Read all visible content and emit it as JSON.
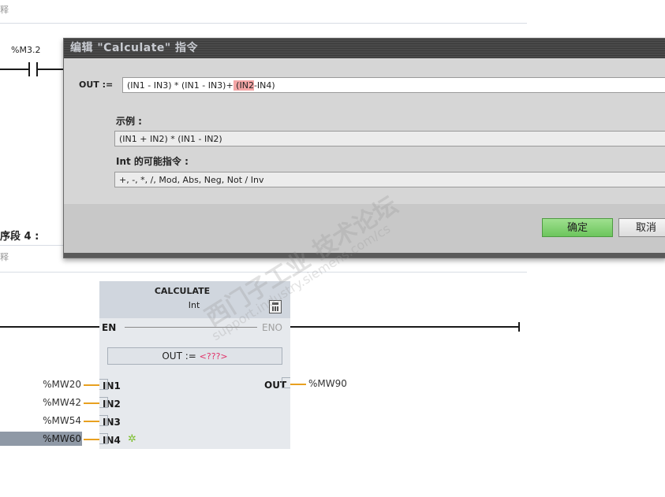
{
  "network_top": {
    "comment_stub": "释",
    "contact_operand": "%M3.2"
  },
  "network4": {
    "title": "序段 4 :",
    "comment_stub": "释"
  },
  "dialog": {
    "title": "编辑 \"Calculate\" 指令",
    "out_label": "OUT :=",
    "expr_before": "(IN1 - IN3) * (IN1 - IN3)+",
    "expr_highlight": " (IN2",
    "expr_after": "-IN4)",
    "example_label": "示例 :",
    "example_value": "(IN1 + IN2) * (IN1 - IN2)",
    "ops_label": "Int 的可能指令 :",
    "ops_value": "+, -, *, /, Mod, Abs, Neg, Not / Inv",
    "ok_label": "确定",
    "cancel_label": "取消"
  },
  "block": {
    "name": "CALCULATE",
    "dtype": "Int",
    "en": "EN",
    "eno": "ENO",
    "out_prefix": "OUT :=",
    "out_value": "<???>",
    "out_pin": "OUT",
    "out_operand": "%MW90",
    "inputs": [
      {
        "pin": "IN1",
        "operand": "%MW20"
      },
      {
        "pin": "IN2",
        "operand": "%MW42"
      },
      {
        "pin": "IN3",
        "operand": "%MW54"
      },
      {
        "pin": "IN4",
        "operand": "%MW60"
      }
    ]
  },
  "watermark": {
    "line1": "西门子工业  技术论坛",
    "line2": "support.industry.siemens.com/cs"
  },
  "colors": {
    "operand_tick": "#e8a020",
    "ok_button": "#7ccf6e",
    "highlight": "#f4a6a6",
    "out_value": "#e0336a"
  }
}
